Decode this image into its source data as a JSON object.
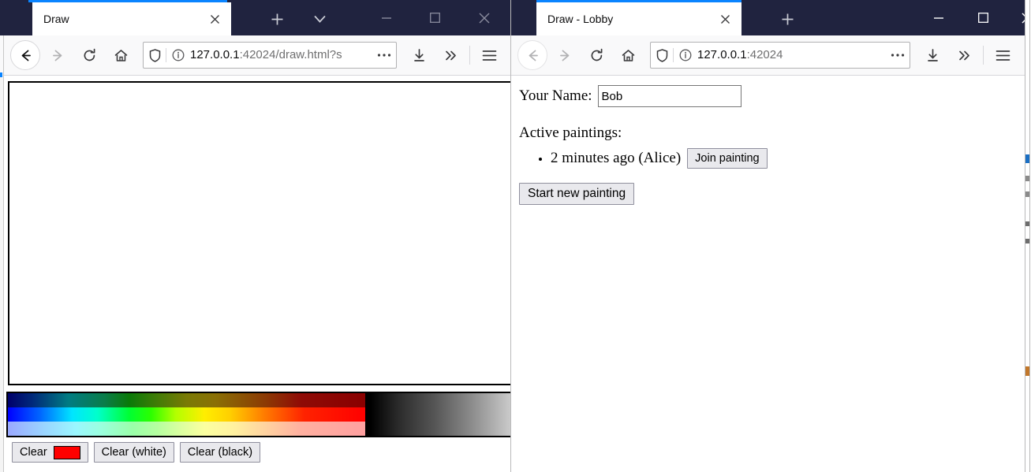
{
  "background_sliver": {
    "left_color": "#2e7ab8",
    "right_color": "#ffffff"
  },
  "left_window": {
    "name": "draw-window",
    "tab": {
      "title": "Draw",
      "close_icon": "close-icon"
    },
    "titlebar_buttons": [
      {
        "icon": "new-tab-icon",
        "label": "+"
      },
      {
        "icon": "chevron-down-icon",
        "label": "v"
      }
    ],
    "window_controls": [
      {
        "icon": "minimize-icon"
      },
      {
        "icon": "maximize-icon"
      },
      {
        "icon": "close-window-icon"
      }
    ],
    "toolbar": {
      "back_icon": "back-arrow-icon",
      "forward_icon": "forward-arrow-icon",
      "reload_icon": "reload-icon",
      "home_icon": "home-icon",
      "shield_icon": "shield-icon",
      "info_icon": "info-circle-icon",
      "url": "127.0.0.1:42024/draw.html?s",
      "url_host": "127.0.0.1",
      "url_rest": ":42024/draw.html?s",
      "page_actions_icon": "ellipsis-icon",
      "downloads_icon": "download-icon",
      "overflow_icon": "double-chevron-right-icon",
      "menu_icon": "hamburger-menu-icon"
    },
    "page": {
      "canvas_name": "drawing-canvas",
      "palette_name": "color-palette",
      "buttons": [
        {
          "label": "Clear",
          "swatch_color": "#ff0000",
          "name": "clear-button"
        },
        {
          "label": "Clear (white)",
          "name": "clear-white-button"
        },
        {
          "label": "Clear (black)",
          "name": "clear-black-button"
        }
      ]
    }
  },
  "right_window": {
    "name": "lobby-window",
    "tab": {
      "title": "Draw - Lobby",
      "close_icon": "close-icon"
    },
    "titlebar_buttons": [
      {
        "icon": "new-tab-icon",
        "label": "+"
      }
    ],
    "window_controls": [
      {
        "icon": "minimize-icon"
      },
      {
        "icon": "maximize-icon"
      },
      {
        "icon": "close-window-icon"
      }
    ],
    "toolbar": {
      "back_icon": "back-arrow-icon",
      "forward_icon": "forward-arrow-icon",
      "reload_icon": "reload-icon",
      "home_icon": "home-icon",
      "shield_icon": "shield-icon",
      "info_icon": "info-circle-icon",
      "url": "127.0.0.1:42024",
      "url_host": "127.0.0.1",
      "url_rest": ":42024",
      "page_actions_icon": "ellipsis-icon",
      "downloads_icon": "download-icon",
      "overflow_icon": "double-chevron-right-icon",
      "menu_icon": "hamburger-menu-icon"
    },
    "page": {
      "name_label": "Your Name:",
      "name_value": "Bob",
      "name_placeholder": "",
      "active_label": "Active paintings:",
      "paintings": [
        {
          "text": "2 minutes ago (Alice)",
          "join_label": "Join painting"
        }
      ],
      "start_label": "Start new painting"
    }
  }
}
